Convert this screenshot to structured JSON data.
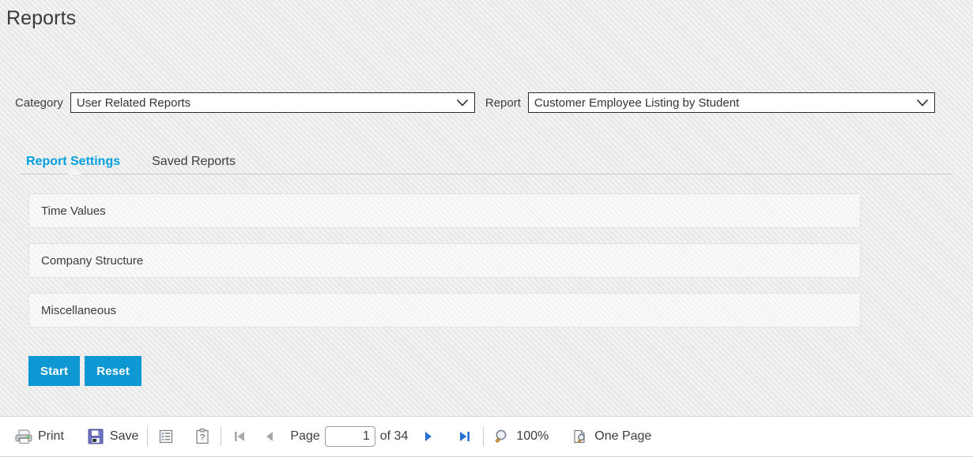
{
  "header": {
    "title": "Reports"
  },
  "selectors": {
    "category": {
      "label": "Category",
      "value": "User Related Reports",
      "icon": "chevron-down-icon"
    },
    "report": {
      "label": "Report",
      "value": "Customer Employee Listing by Student",
      "icon": "chevron-down-icon"
    }
  },
  "tabs": [
    {
      "label": "Report Settings",
      "active": true
    },
    {
      "label": "Saved Reports",
      "active": false
    }
  ],
  "panels": [
    {
      "title": "Time Values"
    },
    {
      "title": "Company Structure"
    },
    {
      "title": "Miscellaneous"
    }
  ],
  "actions": {
    "start_label": "Start",
    "reset_label": "Reset"
  },
  "toolbar": {
    "print_label": "Print",
    "print_icon": "printer-icon",
    "save_label": "Save",
    "save_icon": "floppy-disk-icon",
    "report_list_icon": "report-list-icon",
    "help_icon": "clipboard-question-icon",
    "first_page_icon": "first-page-icon",
    "prev_page_icon": "previous-page-icon",
    "page_label": "Page",
    "page_value": "1",
    "page_of_label": "of 34",
    "next_page_icon": "next-page-icon",
    "last_page_icon": "last-page-icon",
    "zoom_icon": "magnifier-icon",
    "zoom_label": "100%",
    "one_page_icon": "page-view-icon",
    "one_page_label": "One Page"
  },
  "colors": {
    "accent": "#00a0e0",
    "button": "#0d98d4",
    "text": "#3c3c3c",
    "background": "#e9e9e9",
    "panel": "#f4f4f4"
  }
}
